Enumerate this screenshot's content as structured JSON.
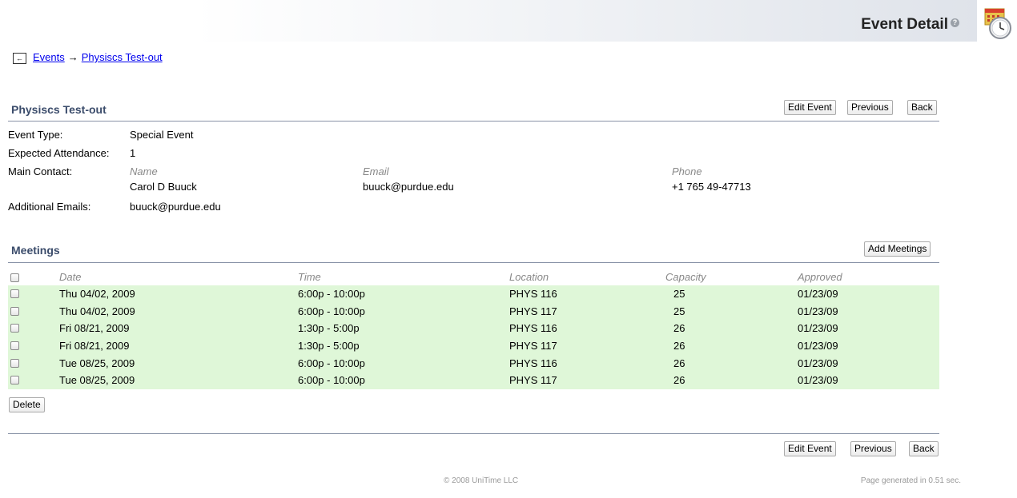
{
  "header": {
    "title": "Event Detail",
    "help": "?"
  },
  "breadcrumb": {
    "back_glyph": "←",
    "items": [
      "Events",
      "Physiscs Test-out"
    ],
    "separator": "→"
  },
  "event": {
    "name": "Physiscs Test-out",
    "buttons": {
      "edit": "Edit Event",
      "previous": "Previous",
      "back": "Back"
    },
    "fields": {
      "type_label": "Event Type:",
      "type_value": "Special Event",
      "attendance_label": "Expected Attendance:",
      "attendance_value": "1",
      "contact_label": "Main Contact:",
      "contact_headers": {
        "name": "Name",
        "email": "Email",
        "phone": "Phone"
      },
      "contact": {
        "name": "Carol D Buuck",
        "email": "buuck@purdue.edu",
        "phone": "+1 765 49-47713"
      },
      "emails_label": "Additional Emails:",
      "emails_value": "buuck@purdue.edu"
    }
  },
  "meetings": {
    "title": "Meetings",
    "add_button": "Add Meetings",
    "columns": [
      "Date",
      "Time",
      "Location",
      "Capacity",
      "Approved"
    ],
    "rows": [
      {
        "date": "Thu 04/02, 2009",
        "time": "6:00p - 10:00p",
        "location": "PHYS 116",
        "capacity": "25",
        "approved": "01/23/09"
      },
      {
        "date": "Thu 04/02, 2009",
        "time": "6:00p - 10:00p",
        "location": "PHYS 117",
        "capacity": "25",
        "approved": "01/23/09"
      },
      {
        "date": "Fri 08/21, 2009",
        "time": "1:30p - 5:00p",
        "location": "PHYS 116",
        "capacity": "26",
        "approved": "01/23/09"
      },
      {
        "date": "Fri 08/21, 2009",
        "time": "1:30p - 5:00p",
        "location": "PHYS 117",
        "capacity": "26",
        "approved": "01/23/09"
      },
      {
        "date": "Tue 08/25, 2009",
        "time": "6:00p - 10:00p",
        "location": "PHYS 116",
        "capacity": "26",
        "approved": "01/23/09"
      },
      {
        "date": "Tue 08/25, 2009",
        "time": "6:00p - 10:00p",
        "location": "PHYS 117",
        "capacity": "26",
        "approved": "01/23/09"
      }
    ],
    "delete_button": "Delete",
    "row_color": "#dff7d8"
  },
  "footer": {
    "copyright": "© 2008 UniTime LLC",
    "generated": "Page generated in 0.51 sec."
  }
}
